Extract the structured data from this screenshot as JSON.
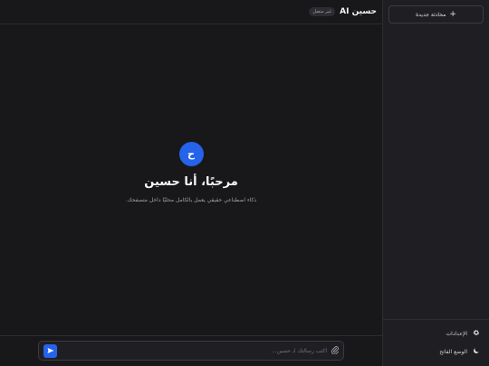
{
  "colors": {
    "accent": "#2563eb",
    "background": "#18181b",
    "sidebar": "#1f1f23"
  },
  "header": {
    "title": "حسين AI",
    "badge": "غير متصل"
  },
  "welcome": {
    "avatar_letter": "ح",
    "title": "مرحبًا، أنا حسين",
    "subtitle": "ذكاء اصطناعي حقيقي يعمل بالكامل محليًا داخل متصفحك."
  },
  "composer": {
    "placeholder": "اكتب رسالتك لـ حسين...",
    "attach_icon": "paperclip-icon",
    "send_icon": "send-icon"
  },
  "sidebar": {
    "new_chat_label": "محادثة جديدة",
    "new_chat_icon": "plus-icon",
    "footer": [
      {
        "label": "الإعدادات",
        "icon": "gear-icon"
      },
      {
        "label": "الوضع الفاتح",
        "icon": "moon-icon"
      }
    ]
  }
}
